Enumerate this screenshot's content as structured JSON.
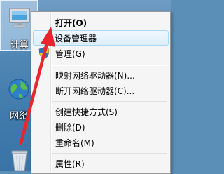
{
  "desktop": {
    "icons": [
      {
        "name": "computer",
        "label": "计算"
      },
      {
        "name": "network",
        "label": "网络"
      },
      {
        "name": "recycle-bin",
        "label": ""
      }
    ]
  },
  "context_menu": {
    "items": [
      {
        "label": "打开(O)",
        "bold": true
      },
      {
        "label": "设备管理器",
        "hover": true
      },
      {
        "label": "管理(G)",
        "icon": "shield-icon"
      },
      {
        "label": "映射网络驱动器(N)..."
      },
      {
        "label": "断开网络驱动器(C)..."
      },
      {
        "label": "创建快捷方式(S)"
      },
      {
        "label": "删除(D)"
      },
      {
        "label": "重命名(M)"
      },
      {
        "label": "属性(R)"
      }
    ]
  },
  "colors": {
    "annotation_arrow": "#e8262d",
    "menu_hover": "#dceefc",
    "desktop": "#4f86b4"
  }
}
